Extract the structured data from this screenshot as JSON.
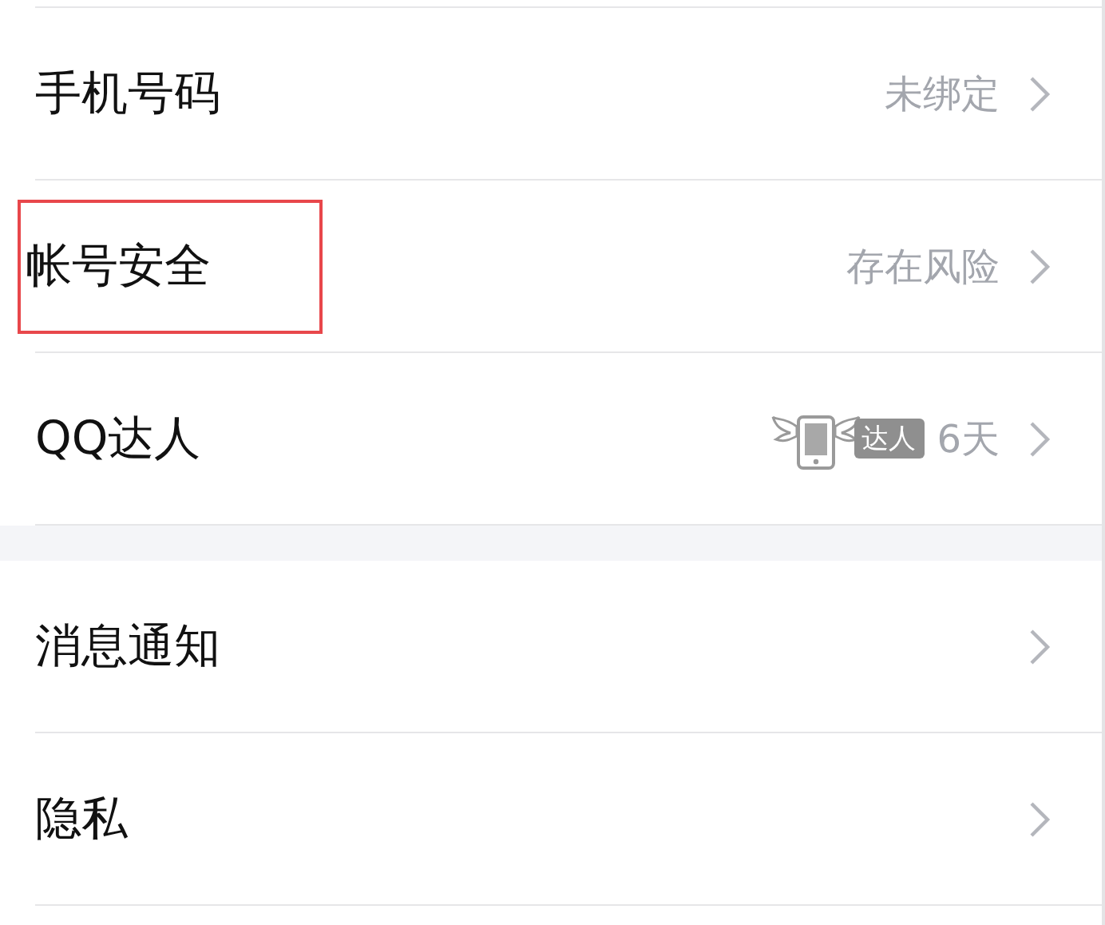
{
  "groups": [
    {
      "items": [
        {
          "label": "手机号码",
          "value": "未绑定",
          "kind": "text",
          "highlighted": false
        },
        {
          "label": "帐号安全",
          "value": "存在风险",
          "kind": "text",
          "highlighted": true
        },
        {
          "label": "QQ达人",
          "badge": "达人",
          "value": "6天",
          "kind": "badge",
          "highlighted": false
        }
      ]
    },
    {
      "items": [
        {
          "label": "消息通知",
          "kind": "plain",
          "highlighted": false
        },
        {
          "label": "隐私",
          "kind": "plain",
          "highlighted": false
        }
      ]
    }
  ]
}
